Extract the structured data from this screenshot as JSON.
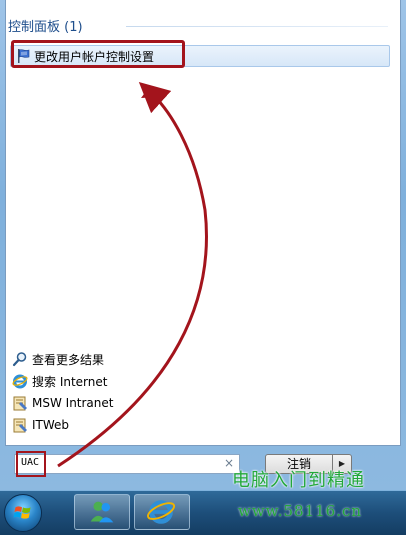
{
  "search_results": {
    "group_header": "控制面板 (1)",
    "items": [
      {
        "label": "更改用户帐户控制设置",
        "icon": "uac-flag-icon"
      }
    ]
  },
  "links": [
    {
      "label": "查看更多结果",
      "icon": "search-icon"
    },
    {
      "label": "搜索 Internet",
      "icon": "ie-icon"
    },
    {
      "label": "MSW Intranet",
      "icon": "intranet-icon"
    },
    {
      "label": "ITWeb",
      "icon": "intranet-icon"
    }
  ],
  "search": {
    "value": "UAC",
    "clear_symbol": "×"
  },
  "shutdown": {
    "label": "注销",
    "arrow": "▶"
  },
  "watermark": {
    "title": "电脑入门到精通",
    "url": "www.58116.cn"
  },
  "colors": {
    "annotation": "#a3141c",
    "header_text": "#1e4e8c",
    "watermark": "#22a83a"
  }
}
